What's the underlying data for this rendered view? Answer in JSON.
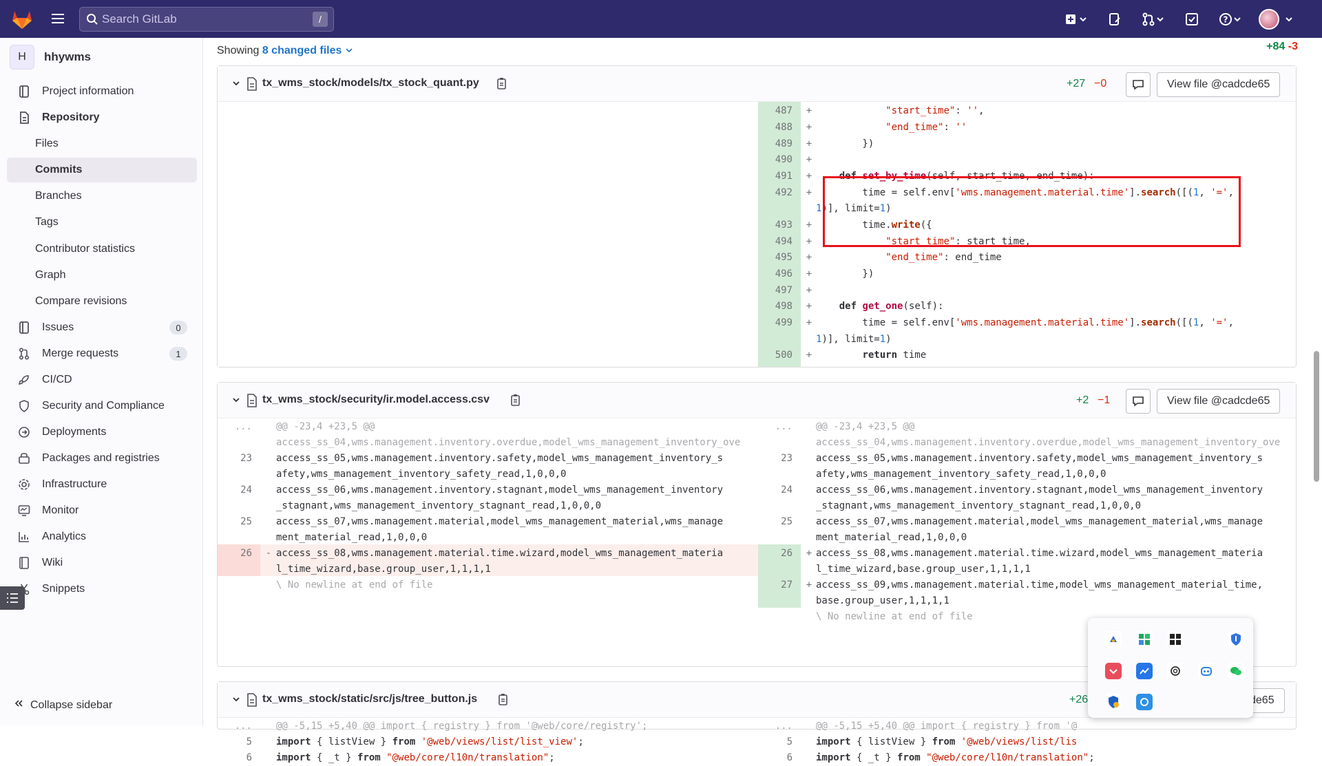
{
  "topbar": {
    "search_placeholder": "Search GitLab",
    "search_shortcut": "/"
  },
  "sidebar": {
    "project_initial": "H",
    "project_name": "hhywms",
    "items": [
      {
        "label": "Project information"
      },
      {
        "label": "Repository"
      },
      {
        "label": "Files"
      },
      {
        "label": "Commits"
      },
      {
        "label": "Branches"
      },
      {
        "label": "Tags"
      },
      {
        "label": "Contributor statistics"
      },
      {
        "label": "Graph"
      },
      {
        "label": "Compare revisions"
      },
      {
        "label": "Issues",
        "badge": "0"
      },
      {
        "label": "Merge requests",
        "badge": "1"
      },
      {
        "label": "CI/CD"
      },
      {
        "label": "Security and Compliance"
      },
      {
        "label": "Deployments"
      },
      {
        "label": "Packages and registries"
      },
      {
        "label": "Infrastructure"
      },
      {
        "label": "Monitor"
      },
      {
        "label": "Analytics"
      },
      {
        "label": "Wiki"
      },
      {
        "label": "Snippets"
      }
    ],
    "collapse_label": "Collapse sidebar"
  },
  "summary": {
    "showing": "Showing",
    "changed_files": "8 changed files",
    "total_add": "+84",
    "total_del": "-3"
  },
  "files": [
    {
      "name": "tx_wms_stock/models/tx_stock_quant.py",
      "additions": "+27",
      "deletions": "−0",
      "view_label": "View file @cadcde65"
    },
    {
      "name": "tx_wms_stock/security/ir.model.access.csv",
      "additions": "+2",
      "deletions": "−1",
      "view_label": "View file @cadcde65"
    },
    {
      "name": "tx_wms_stock/static/src/js/tree_button.js",
      "additions": "+26",
      "view_label": "de65"
    }
  ],
  "diff1": {
    "lines": [
      "487",
      "488",
      "489",
      "490",
      "491",
      "492",
      "493",
      "494",
      "495",
      "496",
      "497",
      "498",
      "499",
      "500"
    ]
  },
  "diff2": {
    "hunk": "@@ -23,4 +23,5 @@",
    "ellipsis": "...",
    "left_first": "access_ss_04,wms.management.inventory.overdue,model_wms_management_inventory_ove",
    "right_first": "access_ss_04,wms.management.inventory.overdue,model_wms_management_inventory_ove",
    "rows": [
      {
        "ln": "23",
        "a": "access_ss_05,wms.management.inventory.safety,model_wms_management_inventory_s",
        "b": "afety,wms_management_inventory_safety_read,1,0,0,0"
      },
      {
        "ln": "24",
        "a": "access_ss_06,wms.management.inventory.stagnant,model_wms_management_inventory",
        "b": "_stagnant,wms_management_inventory_stagnant_read,1,0,0,0"
      },
      {
        "ln": "25",
        "a": "access_ss_07,wms.management.material,model_wms_management_material,wms_manage",
        "b": "ment_material_read,1,0,0,0"
      },
      {
        "ln": "26",
        "a": "access_ss_08,wms.management.material.time.wizard,model_wms_management_materia",
        "b": "l_time_wizard,base.group_user,1,1,1,1"
      }
    ],
    "added_row": {
      "ln": "27",
      "a": "access_ss_09,wms.management.material.time,model_wms_management_material_time,",
      "b": "base.group_user,1,1,1,1"
    },
    "no_newline": "\\ No newline at end of file"
  },
  "diff3": {
    "hunk_left": "@@ -5,15 +5,40 @@ import { registry } from '@web/core/registry';",
    "hunk_right": "@@ -5,15 +5,40 @@ import { registry } from '@",
    "ln5": "5",
    "ln6": "6"
  }
}
